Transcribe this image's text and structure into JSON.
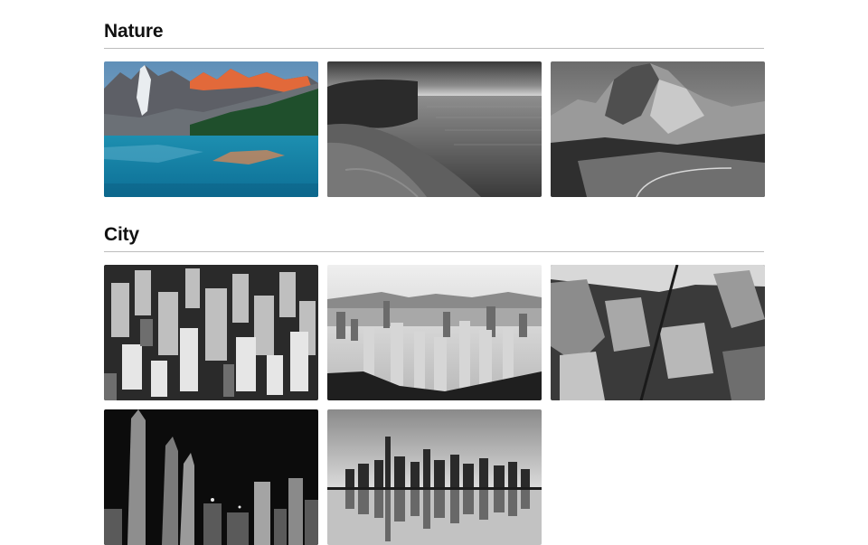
{
  "sections": [
    {
      "title": "Nature",
      "photos": [
        {
          "subject": "mountain-lake",
          "tone": "color"
        },
        {
          "subject": "sea-cliff",
          "tone": "grayscale"
        },
        {
          "subject": "rocky-mountain",
          "tone": "grayscale"
        }
      ]
    },
    {
      "title": "City",
      "photos": [
        {
          "subject": "aerial-city",
          "tone": "grayscale"
        },
        {
          "subject": "city-skyline-hills",
          "tone": "grayscale"
        },
        {
          "subject": "aerial-downtown",
          "tone": "grayscale"
        },
        {
          "subject": "night-skyscrapers",
          "tone": "grayscale"
        },
        {
          "subject": "skyline-reflection",
          "tone": "grayscale"
        }
      ]
    }
  ],
  "colors": {
    "background": "#ffffff",
    "heading": "#111111",
    "divider": "#bdbdbd"
  }
}
